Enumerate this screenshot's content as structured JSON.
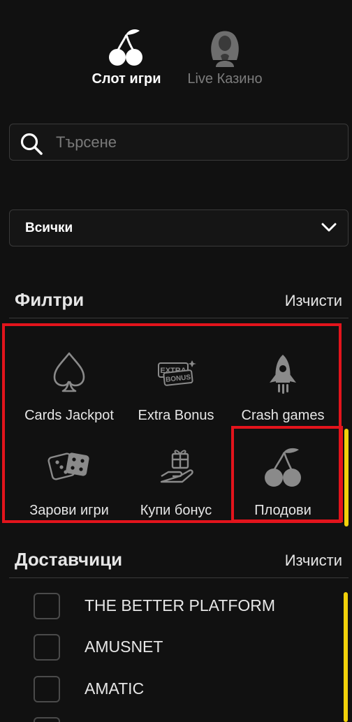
{
  "tabs": [
    {
      "label": "Слот игри",
      "icon": "cherry-icon",
      "active": true
    },
    {
      "label": "Live Казино",
      "icon": "dealer-icon",
      "active": false
    }
  ],
  "search": {
    "placeholder": "Търсене",
    "value": ""
  },
  "category_select": {
    "value": "Всички"
  },
  "filters": {
    "title": "Филтри",
    "clear_label": "Изчисти",
    "items": [
      {
        "label": "Cards Jackpot",
        "icon": "spade-icon"
      },
      {
        "label": "Extra Bonus",
        "icon": "extra-bonus-icon",
        "icon_text": [
          "EXTRA",
          "BONUS"
        ]
      },
      {
        "label": "Crash games",
        "icon": "rocket-icon"
      },
      {
        "label": "Зарови игри",
        "icon": "dice-icon"
      },
      {
        "label": "Купи бонус",
        "icon": "gift-hand-icon"
      },
      {
        "label": "Плодови",
        "icon": "cherry-icon"
      }
    ]
  },
  "providers": {
    "title": "Доставчици",
    "clear_label": "Изчисти",
    "items": [
      {
        "label": "THE BETTER PLATFORM",
        "checked": false
      },
      {
        "label": "AMUSNET",
        "checked": false
      },
      {
        "label": "AMATIC",
        "checked": false
      }
    ]
  },
  "colors": {
    "background": "#111111",
    "highlight": "#e3141c",
    "scroll_accent": "#f2d10a",
    "icon": "#8a8a8a"
  }
}
